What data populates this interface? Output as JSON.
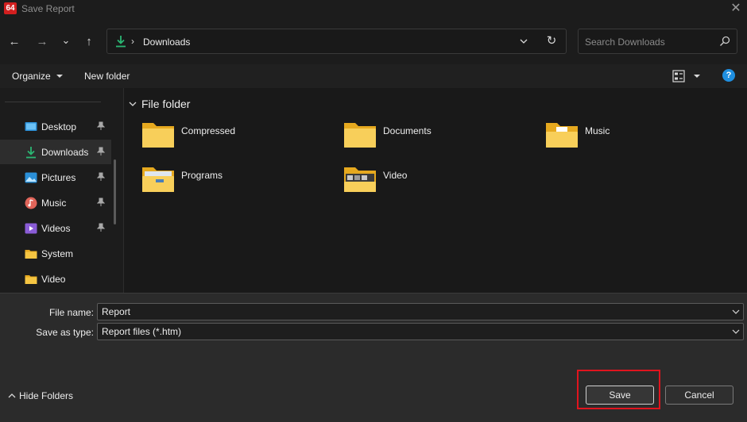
{
  "window": {
    "app_icon_text": "64",
    "title": "Save Report",
    "close_glyph": "✕"
  },
  "nav": {
    "back_glyph": "←",
    "forward_glyph": "→",
    "recent_glyph": "⌄",
    "up_glyph": "↑",
    "address_separator": "›",
    "address_path": "Downloads",
    "refresh_glyph": "↻",
    "search_placeholder": "Search Downloads"
  },
  "toolbar": {
    "organize_label": "Organize",
    "new_folder_label": "New folder",
    "help_glyph": "?"
  },
  "sidebar": {
    "items": [
      {
        "label": "Desktop",
        "icon": "desktop-icon",
        "pinned": true
      },
      {
        "label": "Downloads",
        "icon": "downloads-icon",
        "pinned": true,
        "selected": true
      },
      {
        "label": "Pictures",
        "icon": "pictures-icon",
        "pinned": true
      },
      {
        "label": "Music",
        "icon": "music-icon",
        "pinned": true
      },
      {
        "label": "Videos",
        "icon": "videos-icon",
        "pinned": true
      },
      {
        "label": "System",
        "icon": "folder-icon",
        "pinned": false
      },
      {
        "label": "Video",
        "icon": "folder-icon",
        "pinned": false
      }
    ]
  },
  "content": {
    "group_title": "File folder",
    "folders": [
      {
        "name": "Compressed"
      },
      {
        "name": "Documents"
      },
      {
        "name": "Music"
      },
      {
        "name": "Programs"
      },
      {
        "name": "Video"
      }
    ]
  },
  "form": {
    "file_name_label": "File name:",
    "file_name_value": "Report",
    "save_type_label": "Save as type:",
    "save_type_value": "Report files (*.htm)"
  },
  "footer": {
    "hide_folders_label": "Hide Folders",
    "save_label": "Save",
    "cancel_label": "Cancel"
  },
  "colors": {
    "accent": "#1f8fe0",
    "folder_yellow": "#f5c542",
    "highlight_red": "#e0141e",
    "downloads_green": "#2bb673"
  }
}
